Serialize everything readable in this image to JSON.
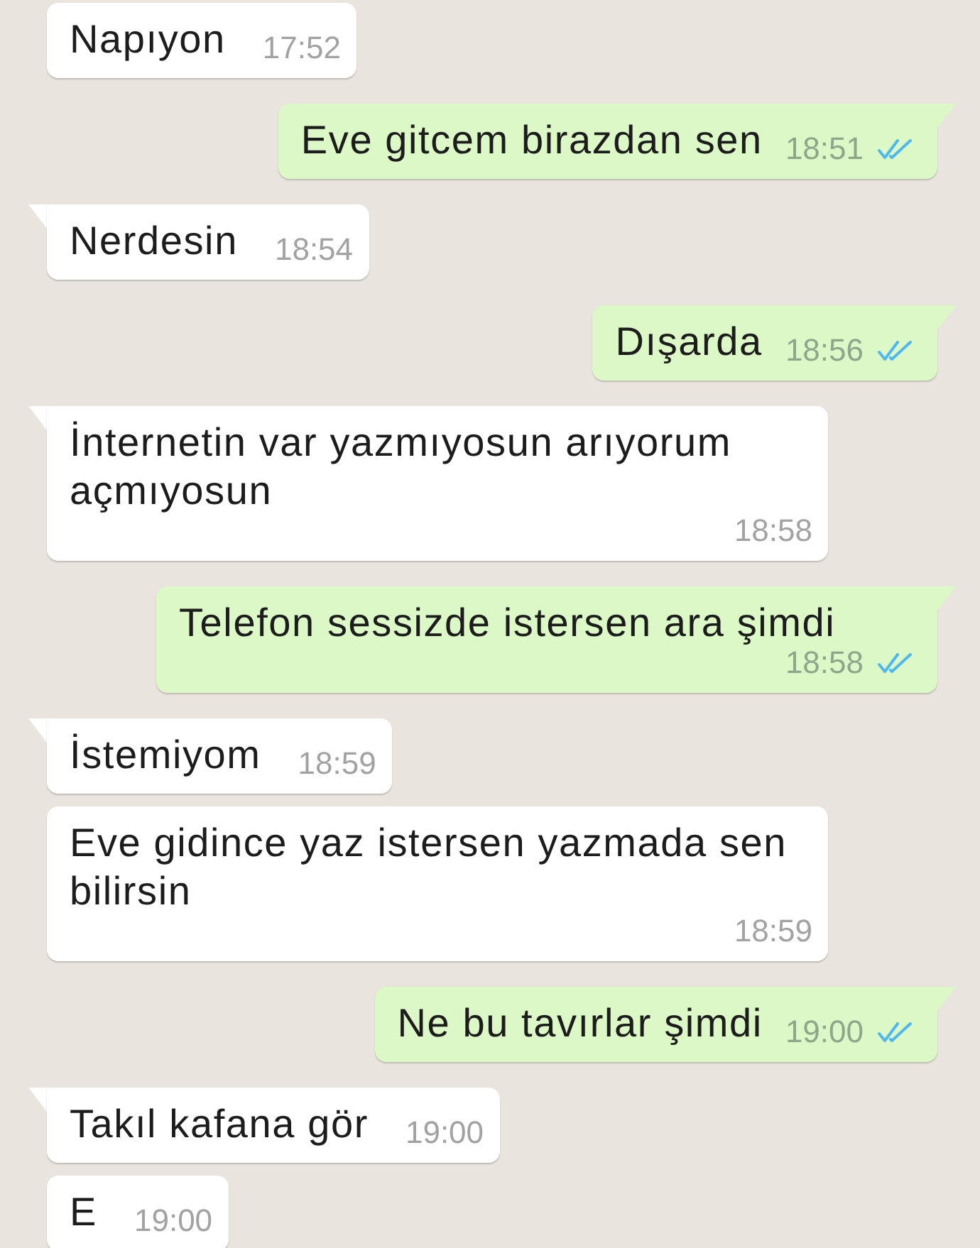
{
  "messages": [
    {
      "kind": "incoming",
      "text": "Napıyon",
      "time": "17:52",
      "tail": false
    },
    {
      "kind": "outgoing",
      "text": "Eve gitcem birazdan sen",
      "time": "18:51",
      "tail": true,
      "read": true
    },
    {
      "kind": "incoming",
      "text": "Nerdesin",
      "time": "18:54",
      "tail": true
    },
    {
      "kind": "outgoing",
      "text": "Dışarda",
      "time": "18:56",
      "tail": true,
      "read": true
    },
    {
      "kind": "incoming",
      "text": "İnternetin var yazmıyosun arıyorum açmıyosun",
      "time": "18:58",
      "tail": true
    },
    {
      "kind": "outgoing",
      "text": "Telefon sessizde istersen ara şimdi",
      "time": "18:58",
      "tail": true,
      "read": true
    },
    {
      "kind": "incoming",
      "text": "İstemiyom",
      "time": "18:59",
      "tail": true
    },
    {
      "kind": "incoming",
      "text": "Eve gidince yaz istersen yazmada sen bilirsin",
      "time": "18:59",
      "tail": false
    },
    {
      "kind": "outgoing",
      "text": "Ne bu tavırlar şimdi",
      "time": "19:00",
      "tail": true,
      "read": true
    },
    {
      "kind": "incoming",
      "text": "Takıl kafana gör",
      "time": "19:00",
      "tail": true
    },
    {
      "kind": "incoming",
      "text": "E",
      "time": "19:00",
      "tail": false
    }
  ]
}
